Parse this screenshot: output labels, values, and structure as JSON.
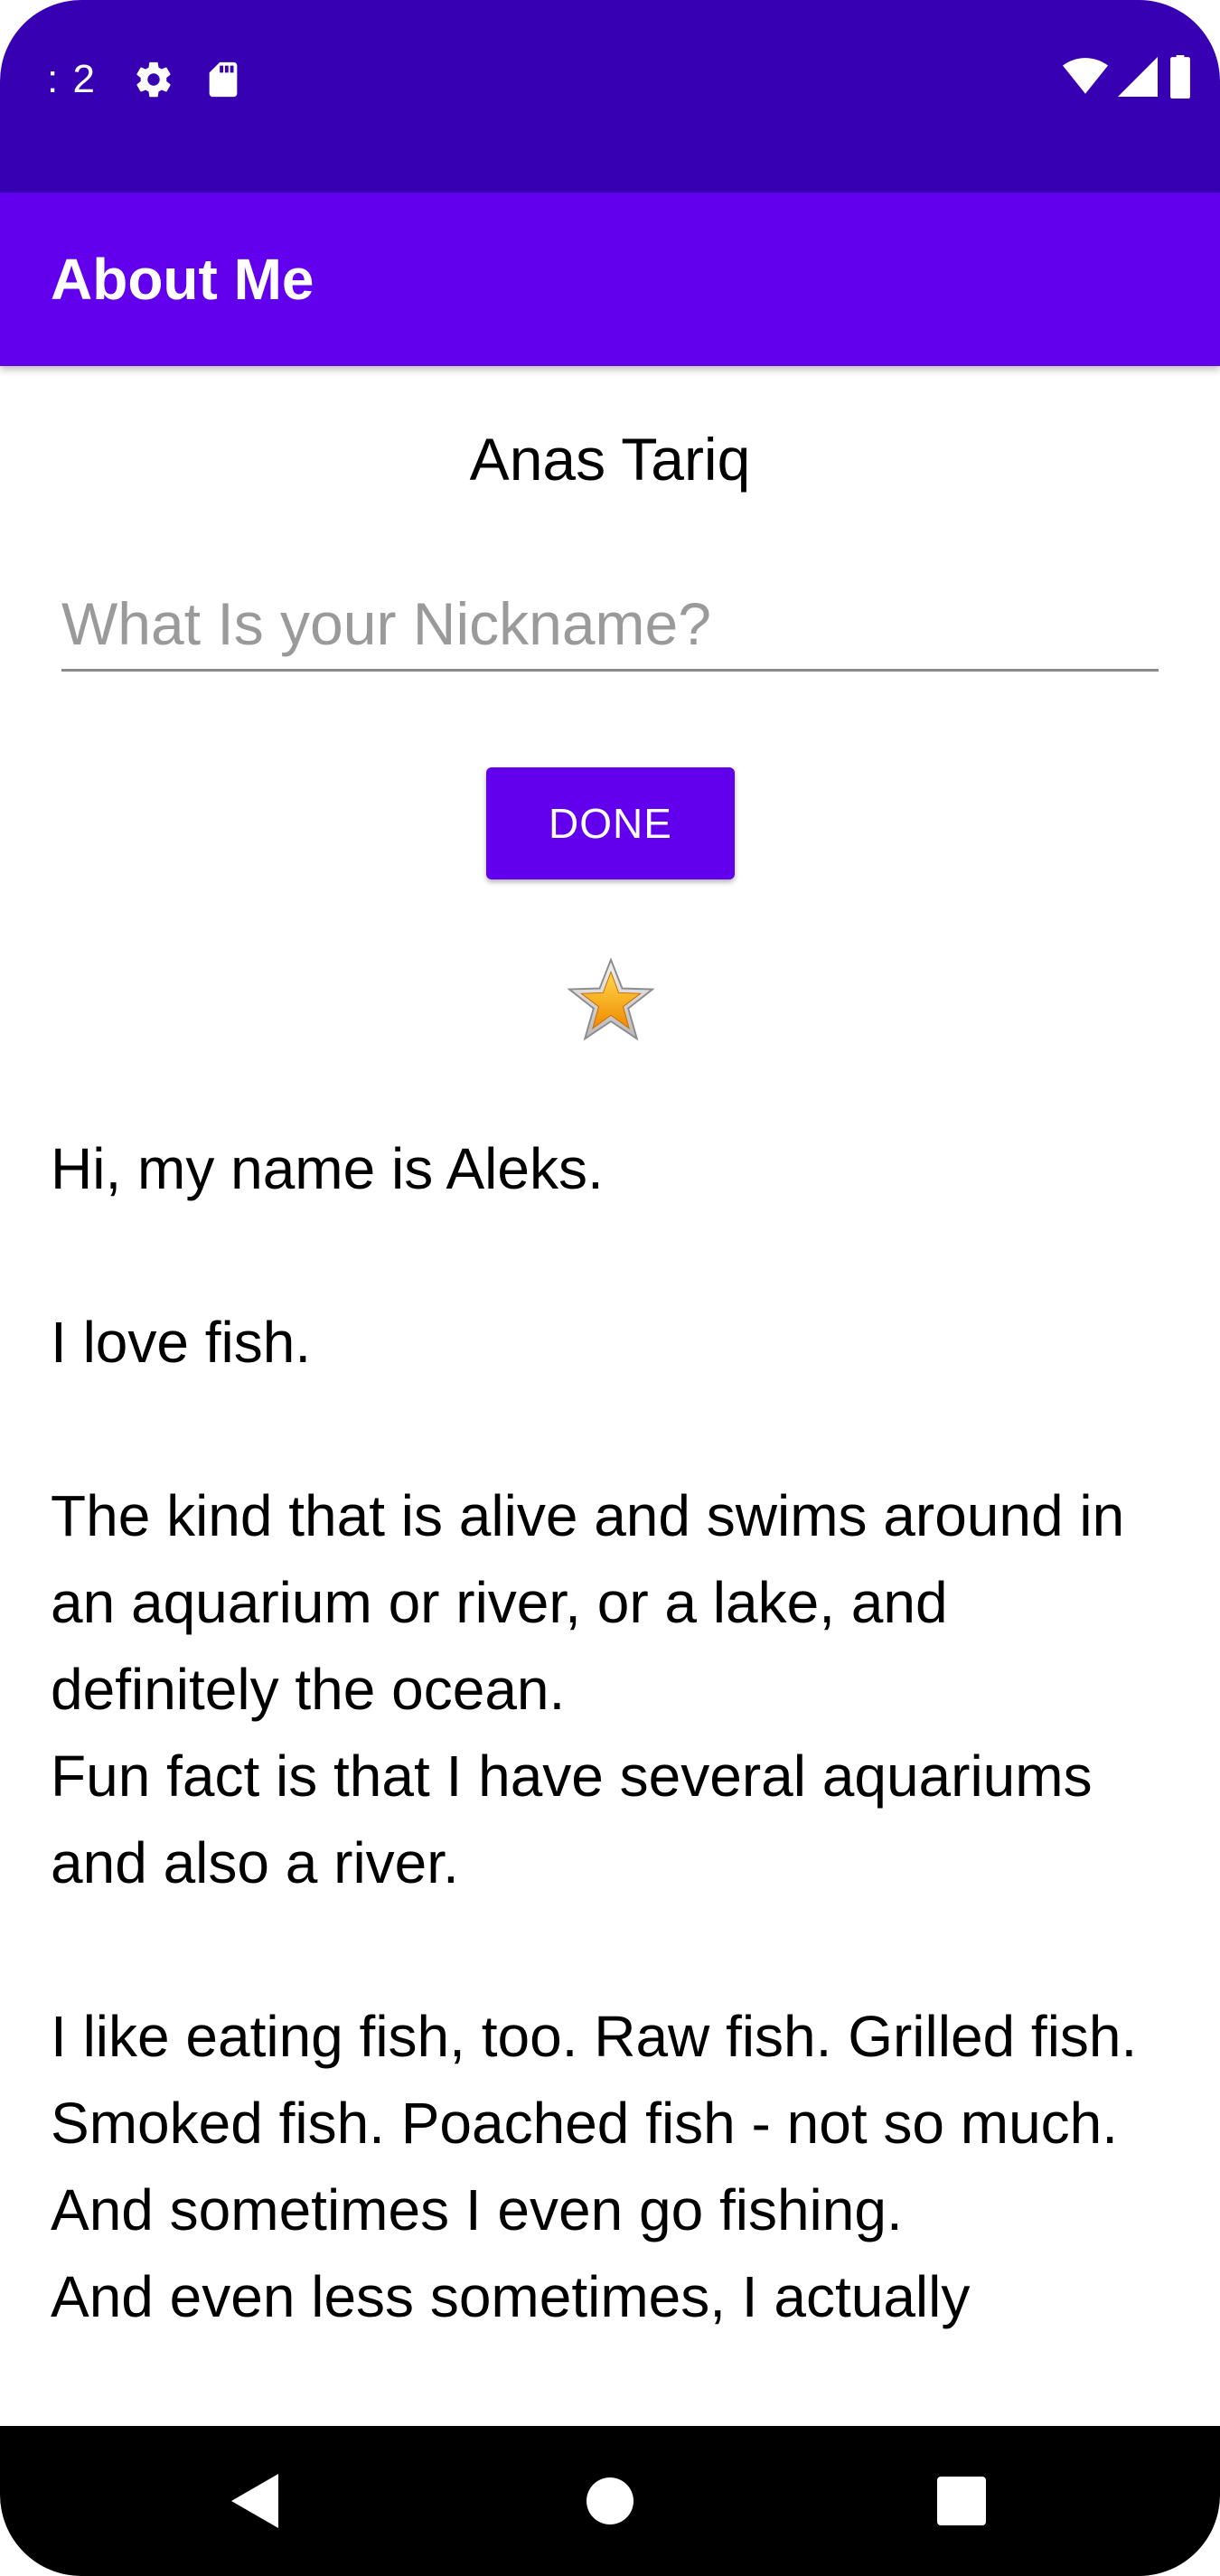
{
  "status_bar": {
    "time": ": 2",
    "icons": [
      "settings-icon",
      "sd-card-icon",
      "wifi-icon",
      "signal-icon",
      "battery-icon"
    ],
    "background": "#3700B3"
  },
  "app_bar": {
    "title": "About Me",
    "background": "#6200EE"
  },
  "profile": {
    "name": "Anas Tariq"
  },
  "nickname": {
    "placeholder": "What Is your Nickname?",
    "value": ""
  },
  "done_button": {
    "label": "DONE",
    "color": "#6200EE"
  },
  "star": {
    "icon": "star-icon"
  },
  "bio": {
    "text": "Hi, my name is Aleks.\n\nI love fish.\n\nThe kind that is alive and swims around in an aquarium or river, or a lake, and definitely the ocean.\nFun fact is that I have several aquariums and also a river.\n\nI like eating fish, too. Raw fish. Grilled fish. Smoked fish. Poached fish - not so much.\nAnd sometimes I even go fishing.\nAnd even less sometimes, I actually"
  },
  "nav_bar": {
    "buttons": [
      "back-icon",
      "home-icon",
      "recents-icon"
    ]
  }
}
